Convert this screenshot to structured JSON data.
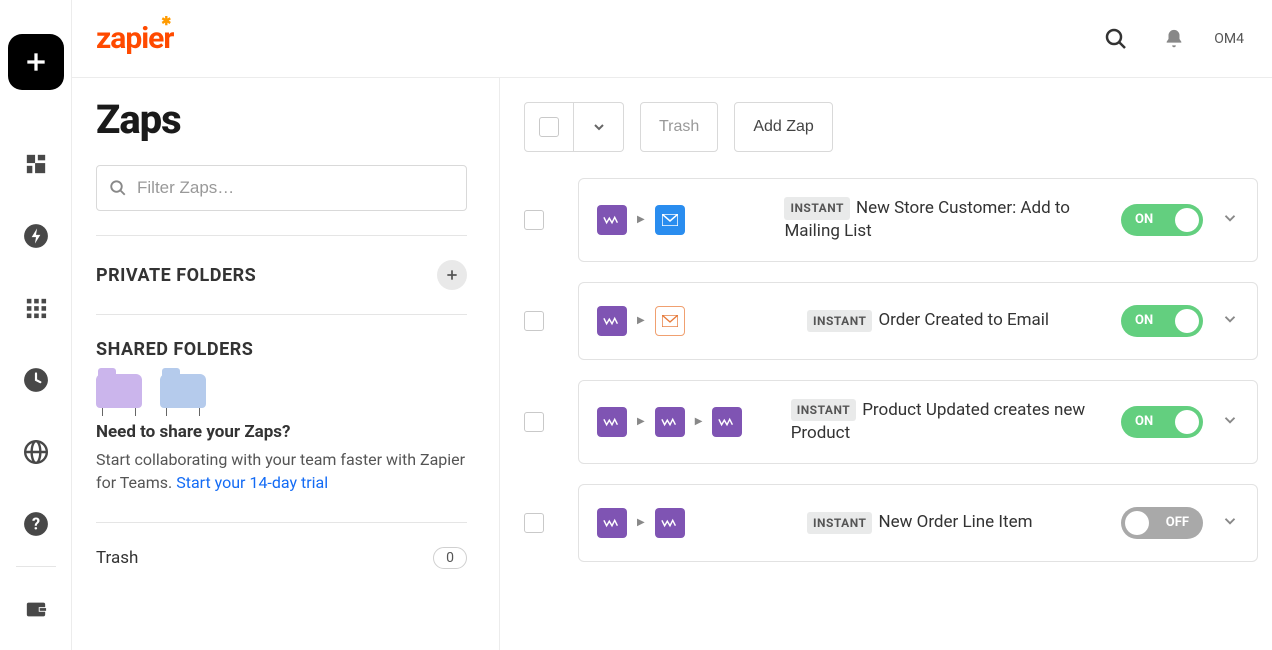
{
  "header": {
    "logo_text": "zapier",
    "user_short": "OM4"
  },
  "page": {
    "title": "Zaps",
    "filter_placeholder": "Filter Zaps…"
  },
  "sidebar": {
    "private_label": "PRIVATE FOLDERS",
    "shared_label": "SHARED FOLDERS",
    "shared_heading": "Need to share your Zaps?",
    "shared_body": "Start collaborating with your team faster with Zapier for Teams. ",
    "shared_link": "Start your 14-day trial",
    "trash_label": "Trash",
    "trash_count": "0"
  },
  "toolbar": {
    "trash_btn": "Trash",
    "add_btn": "Add Zap"
  },
  "badges": {
    "instant": "INSTANT"
  },
  "toggle": {
    "on": "ON",
    "off": "OFF"
  },
  "zaps": [
    {
      "title": "New Store Customer: Add to Mailing List",
      "state": "on"
    },
    {
      "title": "Order Created to Email",
      "state": "on"
    },
    {
      "title": "Product Updated creates new Product",
      "state": "on"
    },
    {
      "title": "New Order Line Item",
      "state": "off"
    }
  ]
}
